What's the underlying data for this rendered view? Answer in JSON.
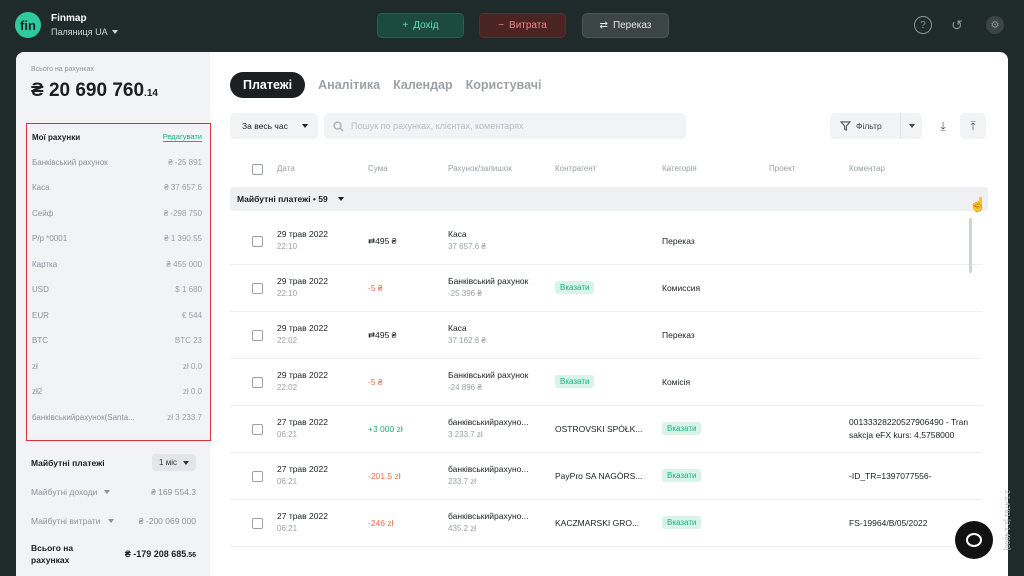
{
  "app": {
    "name": "Finmap",
    "logo_text": "fin",
    "workspace": "Паляниця UA",
    "version": "2.1.4781 [2.1.4800]"
  },
  "toolbar": {
    "income_label": "Дохід",
    "expense_label": "Витрата",
    "transfer_label": "Переказ"
  },
  "sidebar": {
    "total_label": "Всього на рахунках",
    "total_value": "₴ 20 690 760",
    "total_decimal": ".14",
    "accounts_title": "Мої рахунки",
    "edit_label": "Редагувати",
    "accounts": [
      {
        "name": "Банківський рахунок",
        "balance": "₴ -25 891"
      },
      {
        "name": "Каса",
        "balance": "₴ 37 657.6"
      },
      {
        "name": "Сейф",
        "balance": "₴ -298 750"
      },
      {
        "name": "Р/р *0001",
        "balance": "₴ 1 390.55"
      },
      {
        "name": "Картка",
        "balance": "₴ 455 000"
      },
      {
        "name": "USD",
        "balance": "$ 1 680"
      },
      {
        "name": "EUR",
        "balance": "€ 544"
      },
      {
        "name": "BTC",
        "balance": "BTC 23"
      },
      {
        "name": "zł",
        "balance": "zł 0.0"
      },
      {
        "name": "zł2",
        "balance": "zł 0.0"
      },
      {
        "name": "банківськийрахунок(Santa...",
        "balance": "zł 3 233.7"
      }
    ],
    "future_title": "Майбутні платежі",
    "future_period": "1 міс",
    "future_income_label": "Майбутні доходи",
    "future_income_value": "₴ 169 554.3",
    "future_expense_label": "Майбутні витрати",
    "future_expense_value": "₴ -200 069 000",
    "sum_label": "Всього на рахунках",
    "sum_value": "₴ -179 208 685",
    "sum_decimal": ".56"
  },
  "tabs": [
    "Платежі",
    "Аналітика",
    "Календар",
    "Користувачі"
  ],
  "filters": {
    "period": "За весь час",
    "search_placeholder": "Пошук по рахунках, клієнтах, коментарях",
    "filter_label": "Фільтр"
  },
  "table": {
    "columns": [
      "Дата",
      "Сума",
      "Рахунок/залишок",
      "Контрагент",
      "Категорія",
      "Проект",
      "Коментар"
    ],
    "group_label": "Майбутні платежі • 59",
    "rows": [
      {
        "date": "29 трав 2022",
        "time": "22:10",
        "amount": "⇄495 ₴",
        "amount_type": "neutral",
        "account": "Каса",
        "balance": "37 657.6 ₴",
        "counterparty": "",
        "category": "Переказ",
        "category_badge": "",
        "project": "",
        "comment": "",
        "comment2": ""
      },
      {
        "date": "29 трав 2022",
        "time": "22:10",
        "amount": "-5 ₴",
        "amount_type": "neg",
        "account": "Банківський рахунок",
        "balance": "-25 396 ₴",
        "counterparty": "",
        "counterparty_badge": "Вказати",
        "category": "Комиссия",
        "category_badge": "",
        "project": "",
        "comment": "",
        "comment2": ""
      },
      {
        "date": "29 трав 2022",
        "time": "22:02",
        "amount": "⇄495 ₴",
        "amount_type": "neutral",
        "account": "Каса",
        "balance": "37 162.6 ₴",
        "counterparty": "",
        "category": "Переказ",
        "category_badge": "",
        "project": "",
        "comment": "",
        "comment2": ""
      },
      {
        "date": "29 трав 2022",
        "time": "22:02",
        "amount": "-5 ₴",
        "amount_type": "neg",
        "account": "Банківський рахунок",
        "balance": "-24 896 ₴",
        "counterparty": "",
        "counterparty_badge": "Вказати",
        "category": "Комісія",
        "category_badge": "",
        "project": "",
        "comment": "",
        "comment2": ""
      },
      {
        "date": "27 трав 2022",
        "time": "06:21",
        "amount": "+3 000 zł",
        "amount_type": "pos",
        "account": "банківськийрахуно...",
        "balance": "3 233.7 zł",
        "counterparty": "OSTROVSKI SPÓŁK...",
        "category": "",
        "category_badge": "Вказати",
        "project": "",
        "comment": "00133328220527906490 - Tran",
        "comment2": "sakcja eFX kurs: 4,5758000"
      },
      {
        "date": "27 трав 2022",
        "time": "06:21",
        "amount": "-201.5 zł",
        "amount_type": "neg",
        "account": "банківськийрахуно...",
        "balance": "233.7 zł",
        "counterparty": "PayPro SA NAGÓRS...",
        "category": "",
        "category_badge": "Вказати",
        "project": "",
        "comment": "-ID_TR=1397077556-",
        "comment2": ""
      },
      {
        "date": "27 трав 2022",
        "time": "06:21",
        "amount": "-246 zł",
        "amount_type": "neg",
        "account": "банківськийрахуно...",
        "balance": "435.2 zł",
        "counterparty": "KACZMARSKI GRO...",
        "category": "",
        "category_badge": "Вказати",
        "project": "",
        "comment": "FS-19964/B/05/2022",
        "comment2": ""
      }
    ]
  },
  "colors": {
    "accent": "#1fae83",
    "highlight_border": "#d9313a",
    "negative": "#e8704a",
    "positive": "#20a979"
  }
}
